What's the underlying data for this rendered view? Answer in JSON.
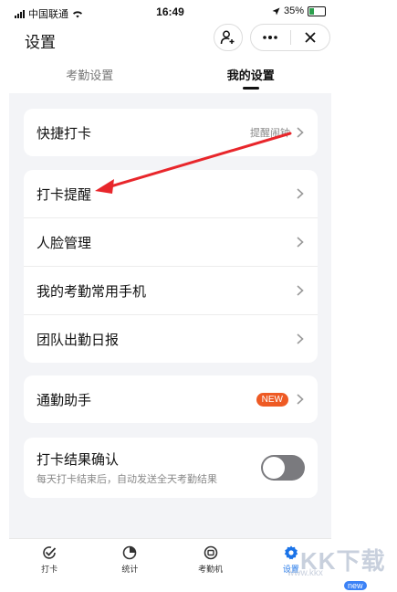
{
  "status_bar": {
    "carrier": "中国联通",
    "time": "16:49",
    "battery": "35%"
  },
  "header": {
    "title": "设置"
  },
  "tabs": [
    {
      "label": "考勤设置",
      "active": false
    },
    {
      "label": "我的设置",
      "active": true
    }
  ],
  "quick_punch": {
    "label": "快捷打卡",
    "hint": "提醒闹钟"
  },
  "settings_list": [
    {
      "label": "打卡提醒"
    },
    {
      "label": "人脸管理"
    },
    {
      "label": "我的考勤常用手机"
    },
    {
      "label": "团队出勤日报"
    }
  ],
  "commute": {
    "label": "通勤助手",
    "badge": "NEW"
  },
  "punch_confirm": {
    "label": "打卡结果确认",
    "description": "每天打卡结束后，自动发送全天考勤结果",
    "enabled": false
  },
  "bottom_tabs": [
    {
      "label": "打卡",
      "icon": "check-circle-icon"
    },
    {
      "label": "统计",
      "icon": "pie-chart-icon"
    },
    {
      "label": "考勤机",
      "icon": "attendance-machine-icon"
    },
    {
      "label": "设置",
      "icon": "gear-icon",
      "active": true
    }
  ],
  "watermark": {
    "text": "KK下载",
    "url": "www.kkx",
    "badge": "new"
  },
  "colors": {
    "accent": "#1a73e8",
    "badge": "#ee5a24",
    "arrow": "#e8262b"
  }
}
